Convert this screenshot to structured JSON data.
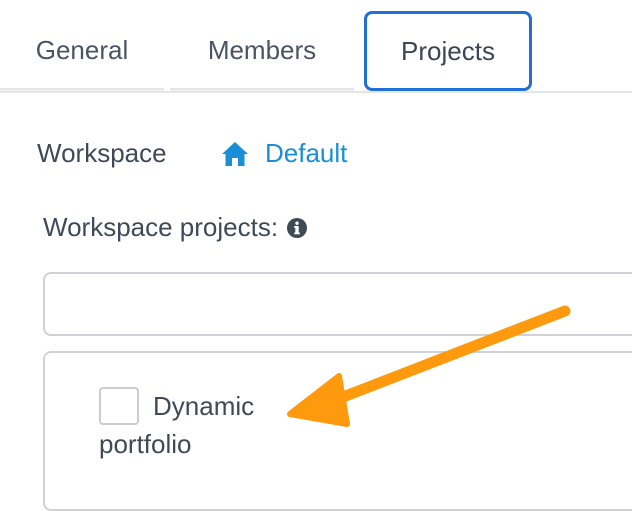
{
  "tabs": [
    {
      "label": "General"
    },
    {
      "label": "Members"
    },
    {
      "label": "Projects"
    }
  ],
  "workspace": {
    "label": "Workspace",
    "value": "Default",
    "icon": "home-icon"
  },
  "projects": {
    "label": "Workspace projects:",
    "info_icon": "info-icon",
    "search": {
      "value": "",
      "placeholder": ""
    },
    "items": [
      {
        "label": "Dynamic portfolio",
        "checked": false
      }
    ]
  },
  "annotation": {
    "icon": "arrow-icon",
    "color": "#ff9a0f"
  },
  "colors": {
    "active_tab_border": "#1f6fd6",
    "link": "#1a8fd6",
    "text": "#3f4a57"
  }
}
